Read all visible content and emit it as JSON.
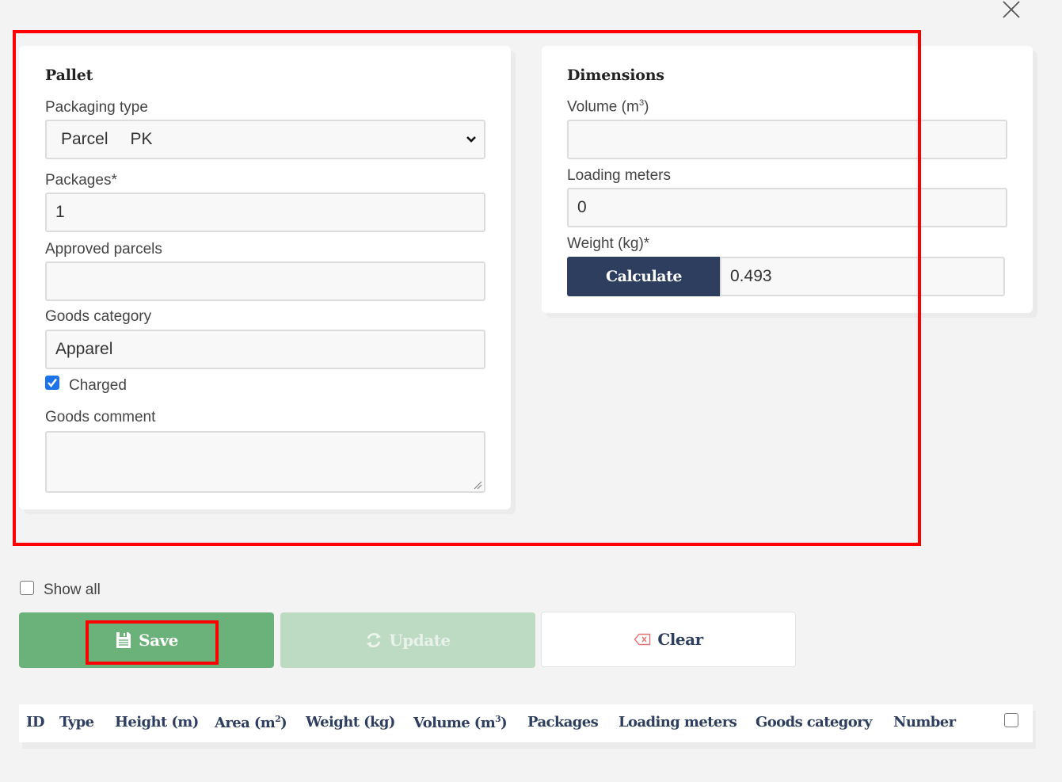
{
  "dialog": {
    "close_label": "Close"
  },
  "pallet": {
    "title": "Pallet",
    "packaging_type": {
      "label": "Packaging type",
      "selected_name": "Parcel",
      "selected_code": "PK"
    },
    "packages": {
      "label": "Packages*",
      "value": "1"
    },
    "approved_parcels": {
      "label": "Approved parcels",
      "value": ""
    },
    "goods_category": {
      "label": "Goods category",
      "value": "Apparel"
    },
    "charged": {
      "label": "Charged",
      "checked": true
    },
    "goods_comment": {
      "label": "Goods comment",
      "value": ""
    }
  },
  "dimensions": {
    "title": "Dimensions",
    "volume": {
      "label": "Volume (m",
      "label_sup": "3",
      "label_end": ")",
      "value": ""
    },
    "loading_meters": {
      "label": "Loading meters",
      "value": "0"
    },
    "weight": {
      "label": "Weight (kg)*",
      "value": "0.493",
      "calculate_label": "Calculate"
    }
  },
  "show_all": {
    "label": "Show all",
    "checked": false
  },
  "actions": {
    "save_label": "Save",
    "update_label": "Update",
    "clear_label": "Clear"
  },
  "table": {
    "columns": [
      {
        "label": "ID"
      },
      {
        "label": "Type"
      },
      {
        "label": "Height (m)"
      },
      {
        "label": "Area (m",
        "sup": "2",
        "end": ")"
      },
      {
        "label": "Weight (kg)"
      },
      {
        "label": "Volume (m",
        "sup": "3",
        "end": ")"
      },
      {
        "label": "Packages"
      },
      {
        "label": "Loading meters"
      },
      {
        "label": "Goods category"
      },
      {
        "label": "Number"
      }
    ],
    "select_all_checked": false
  },
  "colors": {
    "highlight": "#ff0000",
    "primary_dark": "#2d3e5f",
    "save_green": "#6bb27a",
    "update_green_disabled": "#bddac3",
    "clear_icon": "#e57373",
    "checkbox_blue": "#1a73e8"
  }
}
